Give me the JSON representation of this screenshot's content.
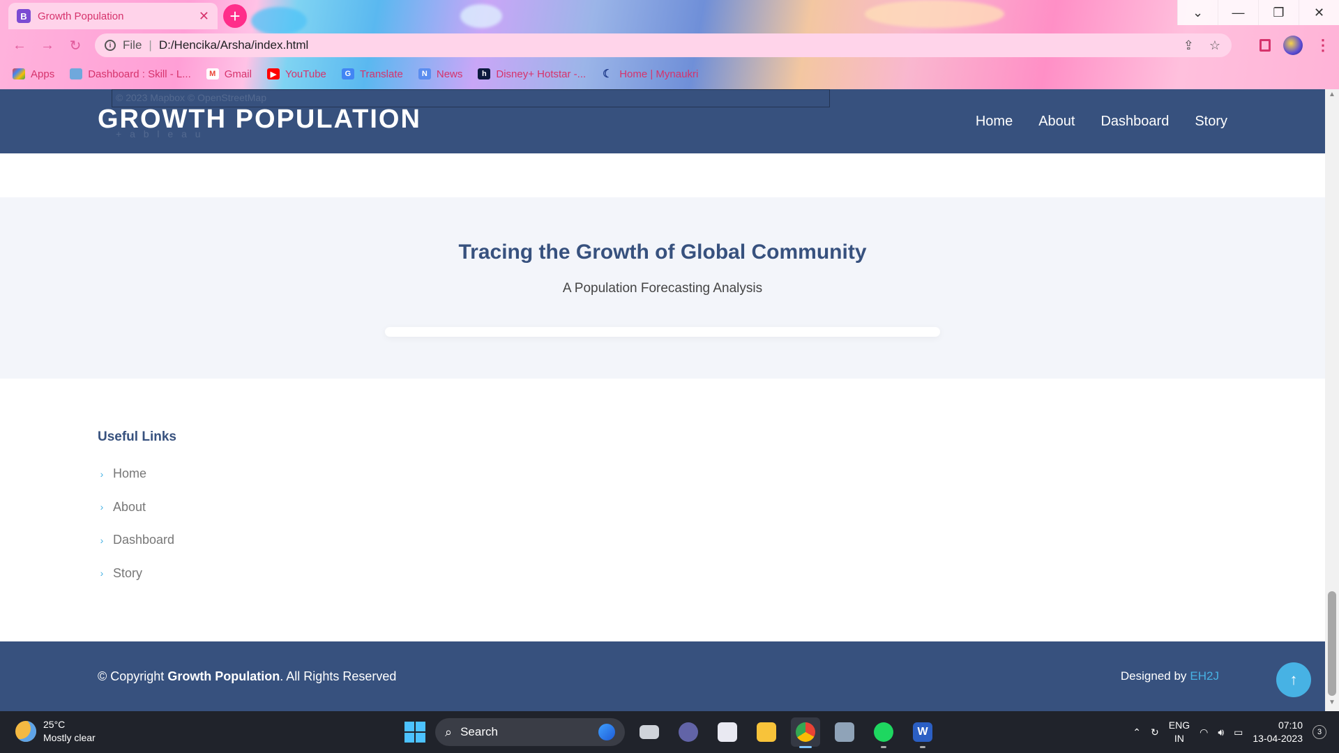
{
  "browser": {
    "tab_title": "Growth Population",
    "tab_favicon": "B",
    "url_scheme": "File",
    "url": "D:/Hencika/Arsha/index.html",
    "bookmarks": [
      {
        "label": "Apps",
        "icon": "apps-grid-icon"
      },
      {
        "label": "Dashboard : Skill - L...",
        "icon": "dashboard-bookmark-icon"
      },
      {
        "label": "Gmail",
        "icon": "gmail-icon"
      },
      {
        "label": "YouTube",
        "icon": "youtube-icon"
      },
      {
        "label": "Translate",
        "icon": "translate-icon"
      },
      {
        "label": "News",
        "icon": "news-icon"
      },
      {
        "label": "Disney+ Hotstar -...",
        "icon": "hotstar-icon"
      },
      {
        "label": "Home | Mynaukri",
        "icon": "mynaukri-icon"
      }
    ]
  },
  "header": {
    "logo": "GROWTH POPULATION",
    "ghost_map_attribution": "© 2023 Mapbox  © OpenStreetMap",
    "ghost_tableau": "+ a b l e a u",
    "nav": [
      "Home",
      "About",
      "Dashboard",
      "Story"
    ]
  },
  "hero": {
    "title": "Tracing the Growth of Global Community",
    "subtitle": "A Population Forecasting Analysis"
  },
  "useful_links": {
    "heading": "Useful Links",
    "items": [
      "Home",
      "About",
      "Dashboard",
      "Story"
    ]
  },
  "footer": {
    "copyright_prefix": "© Copyright",
    "copyright_brand": "Growth Population",
    "copyright_suffix": ". All Rights Reserved",
    "designed_by": "Designed by",
    "designer": "EH2J"
  },
  "taskbar": {
    "temperature": "25°C",
    "weather": "Mostly clear",
    "search_label": "Search",
    "lang_top": "ENG",
    "lang_bottom": "IN",
    "time": "07:10",
    "date": "13-04-2023",
    "notifications": "3"
  },
  "colors": {
    "brand_dark": "#37517e",
    "accent": "#47b2e4",
    "hero_bg": "#f3f5fa"
  }
}
